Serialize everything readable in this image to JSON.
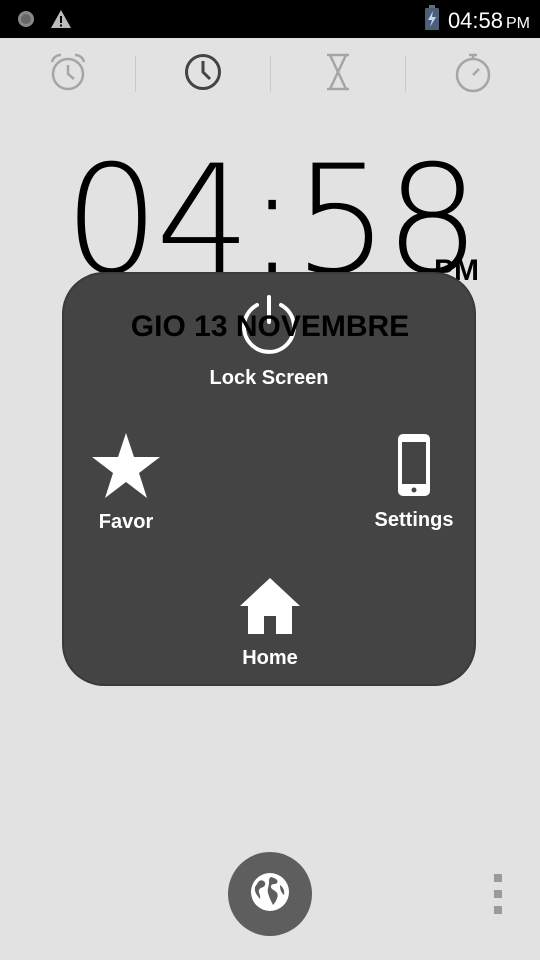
{
  "status_bar": {
    "time": "04:58",
    "ampm": "PM",
    "icons": [
      "record-icon",
      "warning-icon",
      "battery-icon"
    ]
  },
  "tabs": [
    {
      "icon": "alarm-icon",
      "active": false
    },
    {
      "icon": "clock-icon",
      "active": true
    },
    {
      "icon": "hourglass-icon",
      "active": false
    },
    {
      "icon": "stopwatch-icon",
      "active": false
    }
  ],
  "clock": {
    "time": "04:58",
    "ampm": "PM",
    "date": "GIO 13 NOVEMBRE"
  },
  "assistive_menu": {
    "lock_screen": "Lock Screen",
    "favor": "Favor",
    "settings": "Settings",
    "home": "Home"
  },
  "bottom": {
    "globe_icon": "globe-icon",
    "more_icon": "overflow-menu-icon"
  },
  "colors": {
    "background": "#e2e2e2",
    "overlay": "#444444",
    "status_bar": "#000000",
    "tab_icon_inactive": "#a5a5a5",
    "tab_icon_active": "#444444"
  }
}
